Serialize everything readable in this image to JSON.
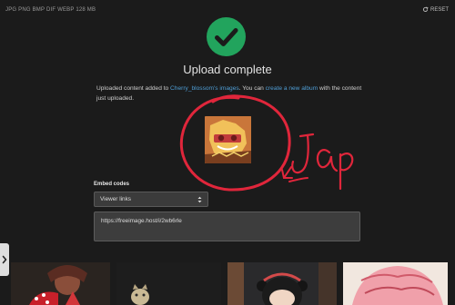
{
  "header": {
    "formats": "JPG PNG BMP DIF WEBP  128 MB",
    "reset_label": "RESET"
  },
  "status": {
    "icon": "checkmark-circle-icon",
    "color": "#22a45d",
    "title": "Upload complete"
  },
  "message": {
    "part1": "Uploaded content added to ",
    "album_link": "Cherry_blossom's images",
    "part2": ". You can ",
    "create_link": "create a new album",
    "part3": " with the content just uploaded."
  },
  "embed": {
    "label": "Embed codes",
    "select_value": "Viewer links",
    "code": "https://freeimage.host/i/2wb6rle"
  },
  "annotation": {
    "text": "Tap",
    "color": "#e0263b"
  },
  "accent_link_color": "#4f9ed6"
}
